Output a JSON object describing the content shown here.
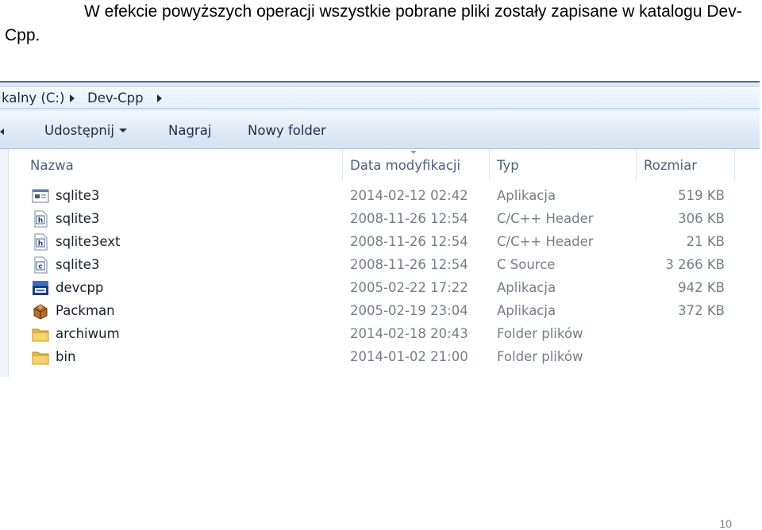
{
  "caption": "W efekcie powyższych operacji wszystkie pobrane pliki zostały zapisane w katalogu Dev-Cpp.",
  "page_number": "10",
  "address": {
    "crumbs": [
      "kalny (C:)",
      "Dev-Cpp"
    ]
  },
  "toolbar": {
    "share_label": "Udostępnij",
    "burn_label": "Nagraj",
    "new_folder_label": "Nowy folder"
  },
  "columns": {
    "name": "Nazwa",
    "date": "Data modyfikacji",
    "type": "Typ",
    "size": "Rozmiar"
  },
  "files": [
    {
      "name": "sqlite3",
      "date": "2014-02-12 02:42",
      "type": "Aplikacja",
      "size": "519 KB",
      "icon": "application-icon"
    },
    {
      "name": "sqlite3",
      "date": "2008-11-26 12:54",
      "type": "C/C++ Header",
      "size": "306 KB",
      "icon": "header-file-icon"
    },
    {
      "name": "sqlite3ext",
      "date": "2008-11-26 12:54",
      "type": "C/C++ Header",
      "size": "21 KB",
      "icon": "header-file-icon"
    },
    {
      "name": "sqlite3",
      "date": "2008-11-26 12:54",
      "type": "C Source",
      "size": "3 266 KB",
      "icon": "c-source-file-icon"
    },
    {
      "name": "devcpp",
      "date": "2005-02-22 17:22",
      "type": "Aplikacja",
      "size": "942 KB",
      "icon": "devcpp-icon"
    },
    {
      "name": "Packman",
      "date": "2005-02-19 23:04",
      "type": "Aplikacja",
      "size": "372 KB",
      "icon": "packman-icon"
    },
    {
      "name": "archiwum",
      "date": "2014-02-18 20:43",
      "type": "Folder plików",
      "size": "",
      "icon": "folder-icon"
    },
    {
      "name": "bin",
      "date": "2014-01-02 21:00",
      "type": "Folder plików",
      "size": "",
      "icon": "folder-icon"
    }
  ]
}
